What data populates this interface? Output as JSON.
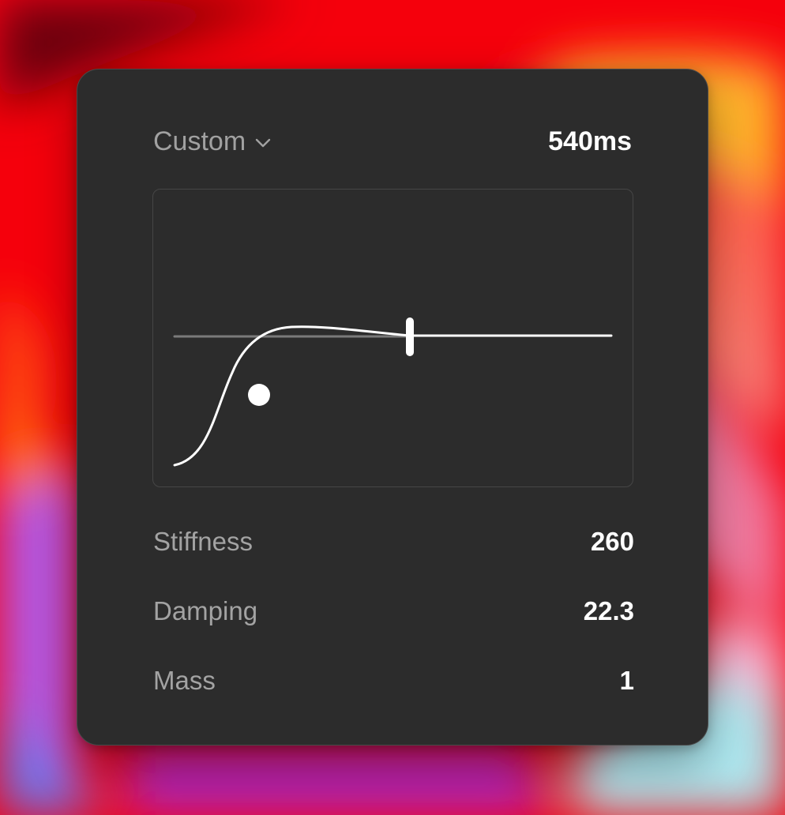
{
  "preset": {
    "label": "Custom",
    "icon": "chevron-down-icon"
  },
  "duration": "540ms",
  "graph": {
    "type": "spring-curve",
    "curve_color": "#ffffff",
    "baseline_color": "#7a7a7a"
  },
  "params": [
    {
      "label": "Stiffness",
      "value": "260"
    },
    {
      "label": "Damping",
      "value": "22.3"
    },
    {
      "label": "Mass",
      "value": "1"
    }
  ],
  "colors": {
    "panel": "#2c2c2c",
    "panel_border": "#4a4a4a",
    "muted_text": "#a1a1a1",
    "bright_text": "#ffffff"
  }
}
